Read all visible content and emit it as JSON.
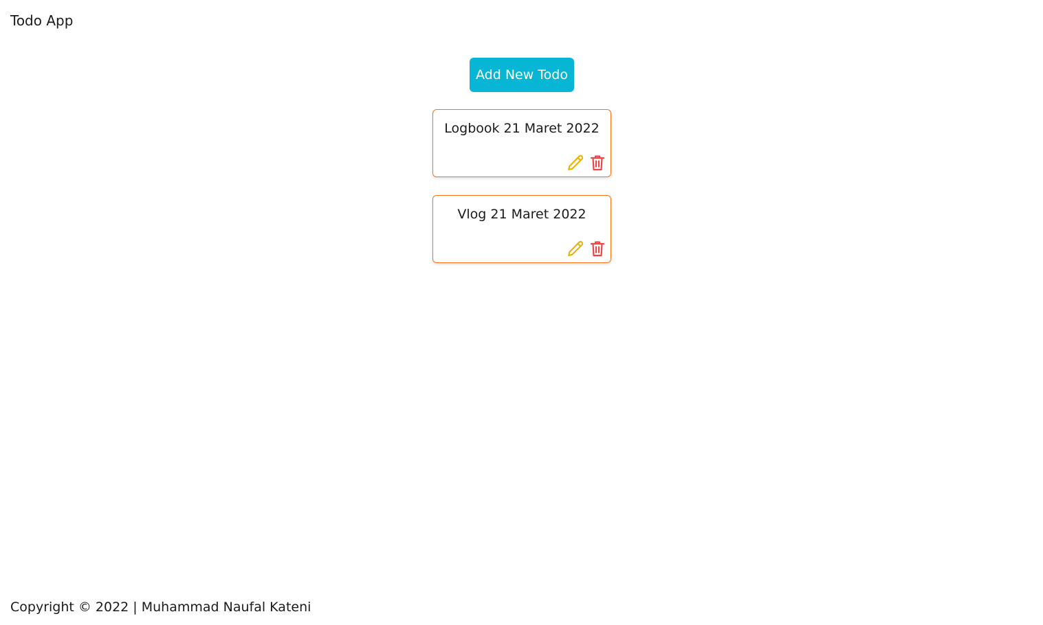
{
  "header": {
    "title": "Todo App"
  },
  "actions": {
    "add_label": "Add New Todo"
  },
  "todos": [
    {
      "title": "Logbook 21 Maret 2022",
      "edit_icon": "pencil-icon",
      "delete_icon": "trash-icon"
    },
    {
      "title": "Vlog 21 Maret 2022",
      "edit_icon": "pencil-icon",
      "delete_icon": "trash-icon"
    }
  ],
  "footer": {
    "text": "Copyright © 2022 | Muhammad Naufal Kateni"
  },
  "colors": {
    "accent": "#06b6d4",
    "card_border": "#f97316",
    "edit_icon": "#eab308",
    "delete_icon": "#ef4444"
  }
}
